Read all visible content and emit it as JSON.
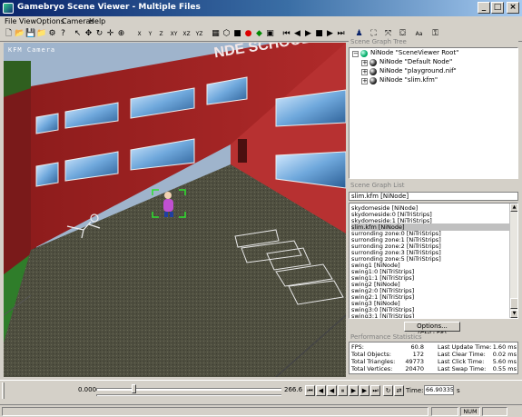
{
  "window": {
    "title": "Gamebryo Scene Viewer - Multiple Files"
  },
  "menu": [
    "File",
    "View",
    "Options",
    "Cameras",
    "Help"
  ],
  "toolbar_labels": {
    "x": "X",
    "y": "Y",
    "z": "Z",
    "xy": "XY",
    "xz": "XZ",
    "yz": "YZ",
    "aa": "Aa"
  },
  "viewport": {
    "camera_label": "KFM Camera",
    "sign_text": "NDE SCHOOL"
  },
  "scene_graph_tree": {
    "title": "Scene Graph Tree",
    "root": "NiNode \"SceneViewer Root\"",
    "children": [
      "NiNode \"Default Node\"",
      "NiNode \"playground.nif\"",
      "NiNode \"slim.kfm\""
    ]
  },
  "scene_graph_list": {
    "title": "Scene Graph List",
    "filter": "slim.kfm [NiNode]",
    "items": [
      "skydomeside [NiNode]",
      "skydomeside:0 [NiTriStrips]",
      "skydomeside:1 [NiTriStrips]",
      "slim.kfm [NiNode]",
      "surronding zone:0 [NiTriStrips]",
      "surronding zone:1 [NiTriStrips]",
      "surronding zone:2 [NiTriStrips]",
      "surronding zone:3 [NiTriStrips]",
      "surronding zone:5 [NiTriStrips]",
      "swing1 [NiNode]",
      "swing1:0 [NiTriStrips]",
      "swing1:1 [NiTriStrips]",
      "swing2 [NiNode]",
      "swing2:0 [NiTriStrips]",
      "swing2:1 [NiTriStrips]",
      "swing3 [NiNode]",
      "swing3:0 [NiTriStrips]",
      "swing3:1 [NiTriStrips]"
    ],
    "selected_index": 3,
    "options_button": "Options... (Ctrl+F6)"
  },
  "performance": {
    "title": "Performance Statistics",
    "left": [
      {
        "label": "FPS:",
        "value": "60.8"
      },
      {
        "label": "Total Objects:",
        "value": "172"
      },
      {
        "label": "Total Triangles:",
        "value": "49773"
      },
      {
        "label": "Total Vertices:",
        "value": "20470"
      }
    ],
    "right": [
      {
        "label": "Last Update Time:",
        "value": "1.60 ms"
      },
      {
        "label": "Last Clear Time:",
        "value": "0.02 ms"
      },
      {
        "label": "Last Click Time:",
        "value": "5.60 ms"
      },
      {
        "label": "Last Swap Time:",
        "value": "0.55 ms"
      }
    ]
  },
  "timeline": {
    "start": "0.000",
    "end": "266.6",
    "position_fraction": 0.2,
    "time_label": "Time:",
    "time_value": "66.903357",
    "time_unit": "s"
  },
  "status": {
    "num": "NUM"
  }
}
